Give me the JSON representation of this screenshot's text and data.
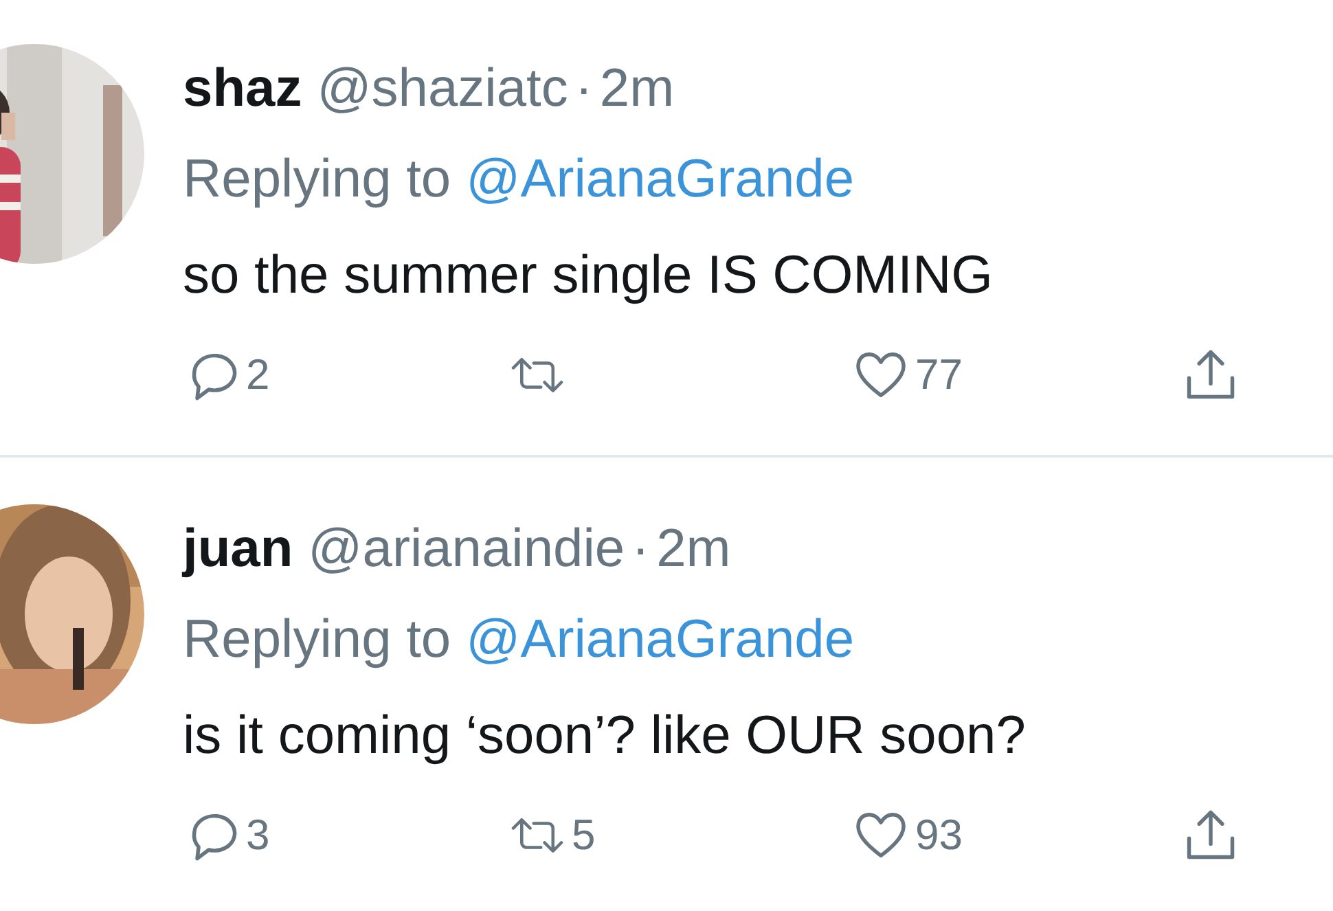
{
  "tweets": [
    {
      "name": "shaz",
      "handle": "@shaziatc",
      "separator": "·",
      "time": "2m",
      "replying_label": "Replying to",
      "replying_to": "@ArianaGrande",
      "text": "so the summer single IS COMING",
      "replies": "2",
      "likes": "77"
    },
    {
      "name": "juan",
      "handle": "@arianaindie",
      "separator": "·",
      "time": "2m",
      "replying_label": "Replying to",
      "replying_to": "@ArianaGrande",
      "text": "is it coming ‘soon’? like OUR soon?",
      "replies": "3",
      "retweets": "5",
      "likes": "93"
    }
  ]
}
